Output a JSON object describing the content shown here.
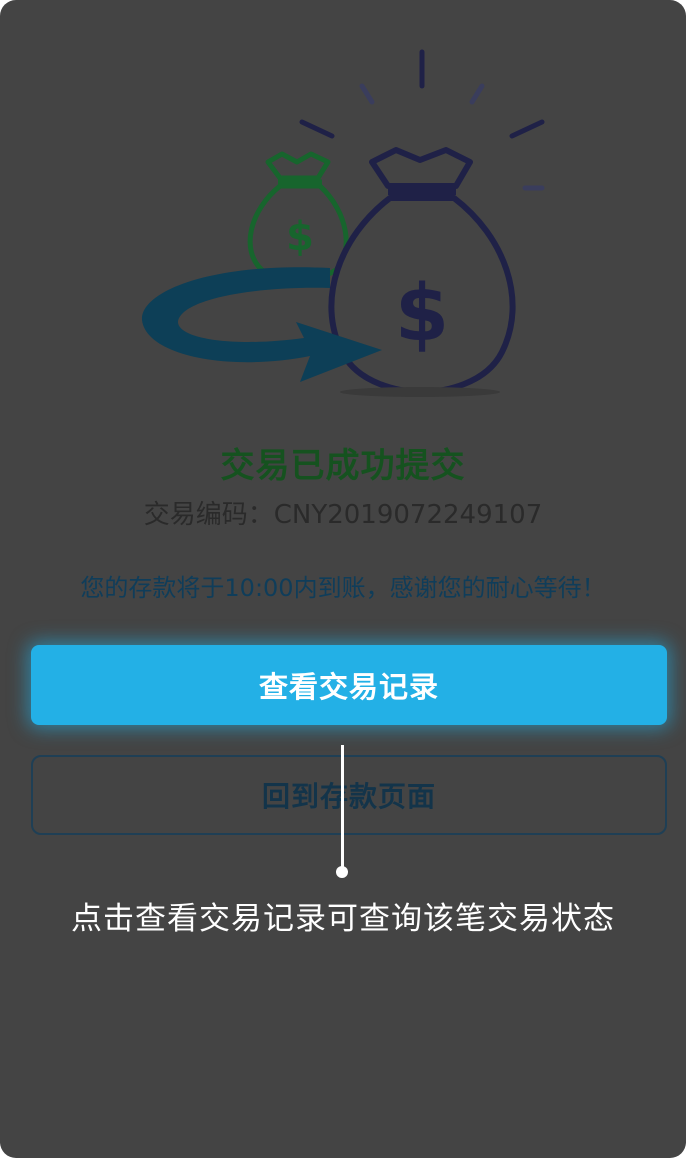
{
  "success": {
    "title": "交易已成功提交",
    "transaction_code_label": "交易编码：CNY2019072249107",
    "notice": "您的存款将于10:00内到账，感谢您的耐心等待！"
  },
  "buttons": {
    "view_records": "查看交易记录",
    "back_to_deposit": "回到存款页面"
  },
  "guide": {
    "hint": "点击查看交易记录可查询该笔交易状态"
  },
  "colors": {
    "overlay": "#444444",
    "title_green": "#15521f",
    "primary_blue": "#23b0e6",
    "bag_navy": "#1f2147",
    "bag_green": "#17652d",
    "arrow_teal": "#0d3f57"
  }
}
